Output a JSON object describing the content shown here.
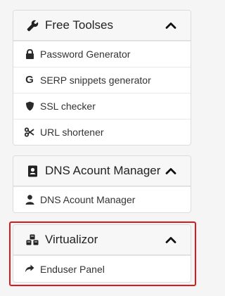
{
  "panels": [
    {
      "title": "Free Toolses",
      "icon": "wrench-icon",
      "items": [
        {
          "label": "Password Generator",
          "icon": "lock-icon"
        },
        {
          "label": "SERP snippets generator",
          "icon": "google-icon"
        },
        {
          "label": "SSL checker",
          "icon": "shield-icon"
        },
        {
          "label": "URL shortener",
          "icon": "scissors-icon"
        }
      ]
    },
    {
      "title": "DNS Acount Manager",
      "icon": "address-book-icon",
      "items": [
        {
          "label": "DNS Acount Manager",
          "icon": "user-icon"
        }
      ]
    },
    {
      "title": "Virtualizor",
      "icon": "cubes-icon",
      "items": [
        {
          "label": "Enduser Panel",
          "icon": "share-icon"
        }
      ]
    }
  ],
  "colors": {
    "highlight_border": "#d81b1b",
    "header_bg": "#f7f7f7",
    "icon": "#2b2b2b"
  }
}
